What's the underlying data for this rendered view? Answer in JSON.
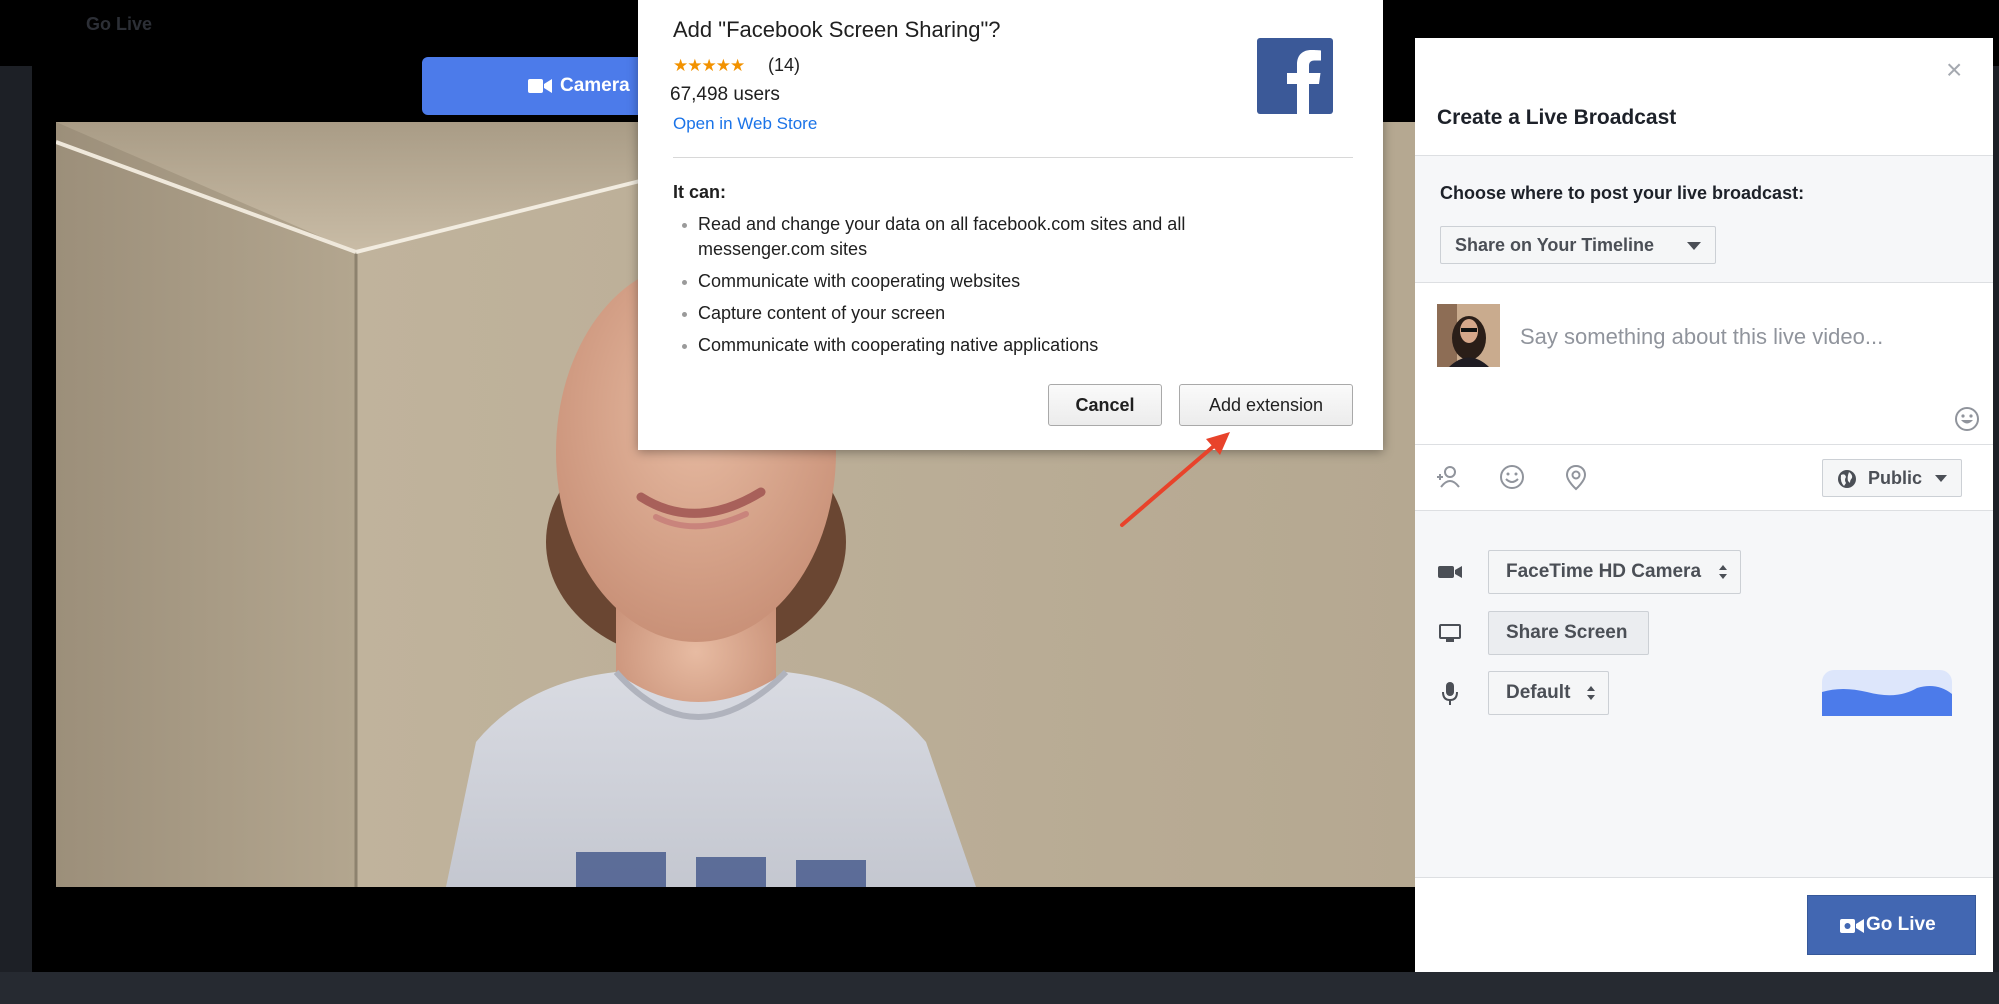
{
  "background": {
    "top_bar_text": "Go Live"
  },
  "camera_tab": {
    "label": "Camera",
    "icon": "video-camera-icon"
  },
  "extension_dialog": {
    "title": "Add \"Facebook Screen Sharing\"?",
    "stars": "★★★★★",
    "rating_count": "(14)",
    "rating_value": 4.5,
    "users": "67,498 users",
    "store_link": "Open in Web Store",
    "logo_icon": "facebook-logo-icon",
    "it_can_label": "It can:",
    "permissions": [
      "Read and change your data on all facebook.com sites and all messenger.com sites",
      "Communicate with cooperating websites",
      "Capture content of your screen",
      "Communicate with cooperating native applications"
    ],
    "cancel_label": "Cancel",
    "add_label": "Add extension"
  },
  "live_panel": {
    "title": "Create a Live Broadcast",
    "where_label": "Choose where to post your live broadcast:",
    "destination": "Share on Your Timeline",
    "status_placeholder": "Say something about this live video...",
    "audience": "Public",
    "camera_select": "FaceTime HD Camera",
    "share_screen_label": "Share Screen",
    "mic_select": "Default",
    "go_live_label": "Go Live"
  },
  "colors": {
    "facebook_blue": "#3b5998",
    "go_live_blue": "#4267b2",
    "camera_tab_blue": "#4c7bea",
    "link_blue": "#1a73e8",
    "star_orange": "#f29200",
    "annotation_arrow": "#e8432b"
  }
}
